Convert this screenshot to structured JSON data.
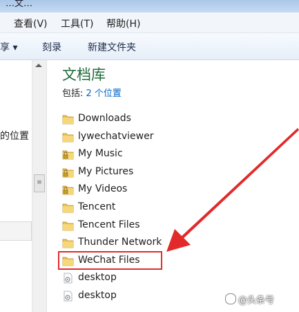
{
  "window": {
    "title_fragment": "…文…"
  },
  "menu": {
    "view": "查看(V)",
    "tools": "工具(T)",
    "help": "帮助(H)"
  },
  "toolbar": {
    "share": "享 ▾",
    "burn": "刻录",
    "new_folder": "新建文件夹"
  },
  "left_pane": {
    "partial_text": "的位置"
  },
  "library": {
    "title": "文档库",
    "includes_label": "包括: ",
    "includes_link": "2 个位置"
  },
  "files": [
    {
      "name": "Downloads",
      "icon": "folder-icon"
    },
    {
      "name": "lywechatviewer",
      "icon": "folder-icon"
    },
    {
      "name": "My Music",
      "icon": "locked-folder-icon"
    },
    {
      "name": "My Pictures",
      "icon": "locked-folder-icon"
    },
    {
      "name": "My Videos",
      "icon": "locked-folder-icon"
    },
    {
      "name": "Tencent",
      "icon": "folder-icon"
    },
    {
      "name": "Tencent Files",
      "icon": "folder-icon"
    },
    {
      "name": "Thunder Network",
      "icon": "folder-icon"
    },
    {
      "name": "WeChat Files",
      "icon": "folder-icon"
    },
    {
      "name": "desktop",
      "icon": "settings-file-icon"
    },
    {
      "name": "desktop",
      "icon": "settings-file-icon"
    }
  ],
  "annotation": {
    "highlight_color": "#e22a2a",
    "highlighted_item": "WeChat Files"
  },
  "watermark": {
    "text": "@头条号"
  }
}
